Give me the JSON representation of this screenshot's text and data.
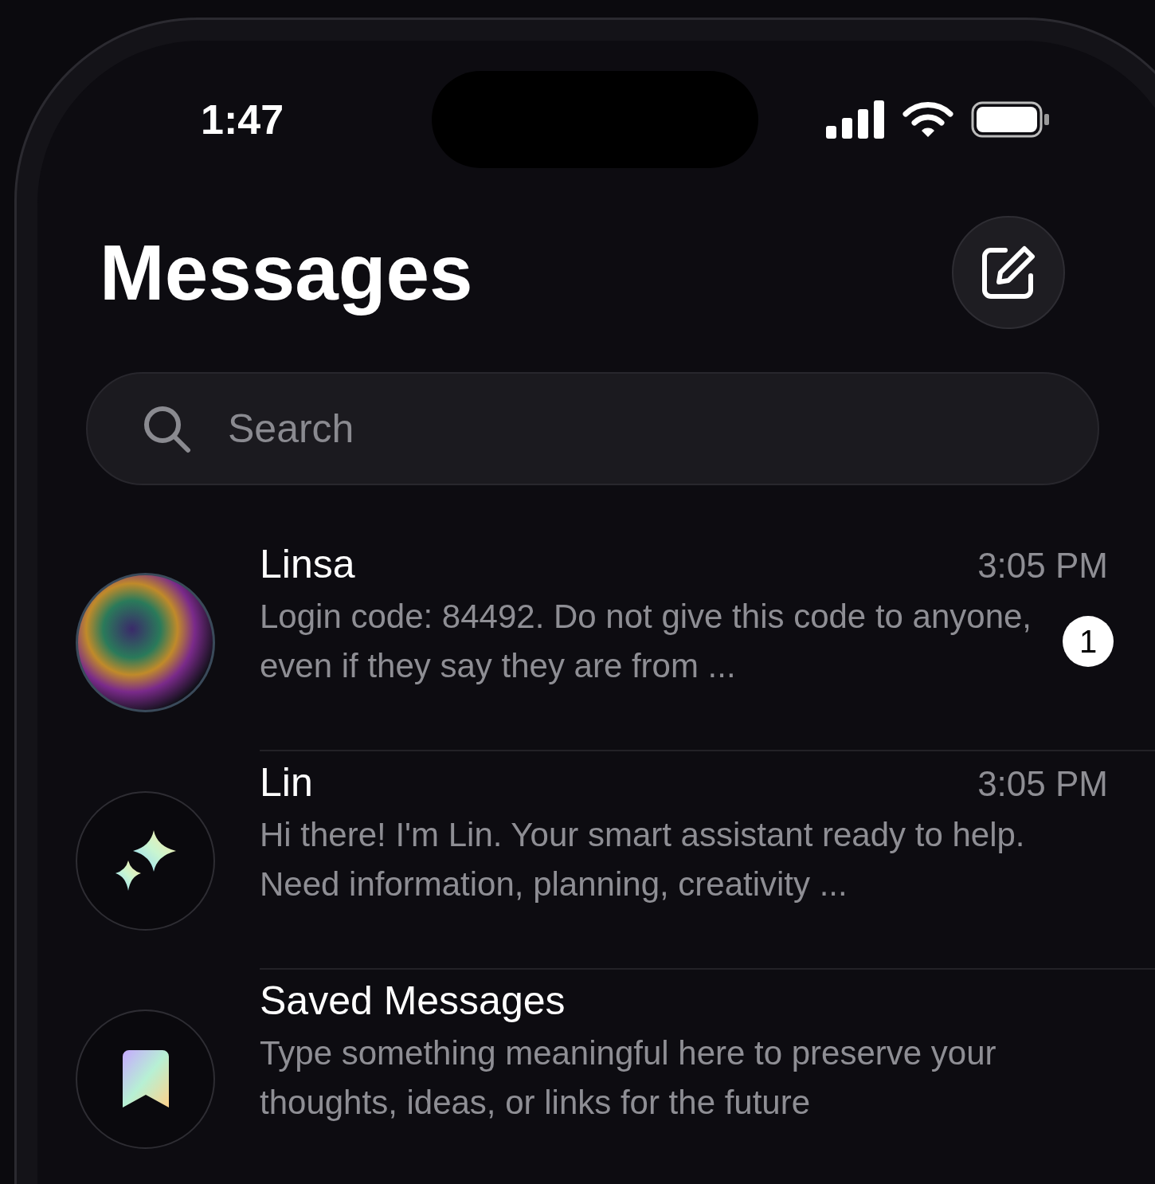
{
  "status_bar": {
    "time": "1:47"
  },
  "title": "Messages",
  "search": {
    "placeholder": "Search"
  },
  "conversations": [
    {
      "kind": "orb",
      "name": "Linsa",
      "time": "3:05 PM",
      "preview": "Login code: 84492. Do not give this code to anyone, even if they say they are from ...",
      "unread_count": "1"
    },
    {
      "kind": "sparkle",
      "name": "Lin",
      "time": "3:05 PM",
      "preview": "Hi there! I'm Lin. Your smart assistant ready to help. Need information, planning, creativity ..."
    },
    {
      "kind": "bookmark",
      "name": "Saved Messages",
      "preview": "Type something meaningful here to preserve your thoughts, ideas, or links for the future"
    }
  ]
}
